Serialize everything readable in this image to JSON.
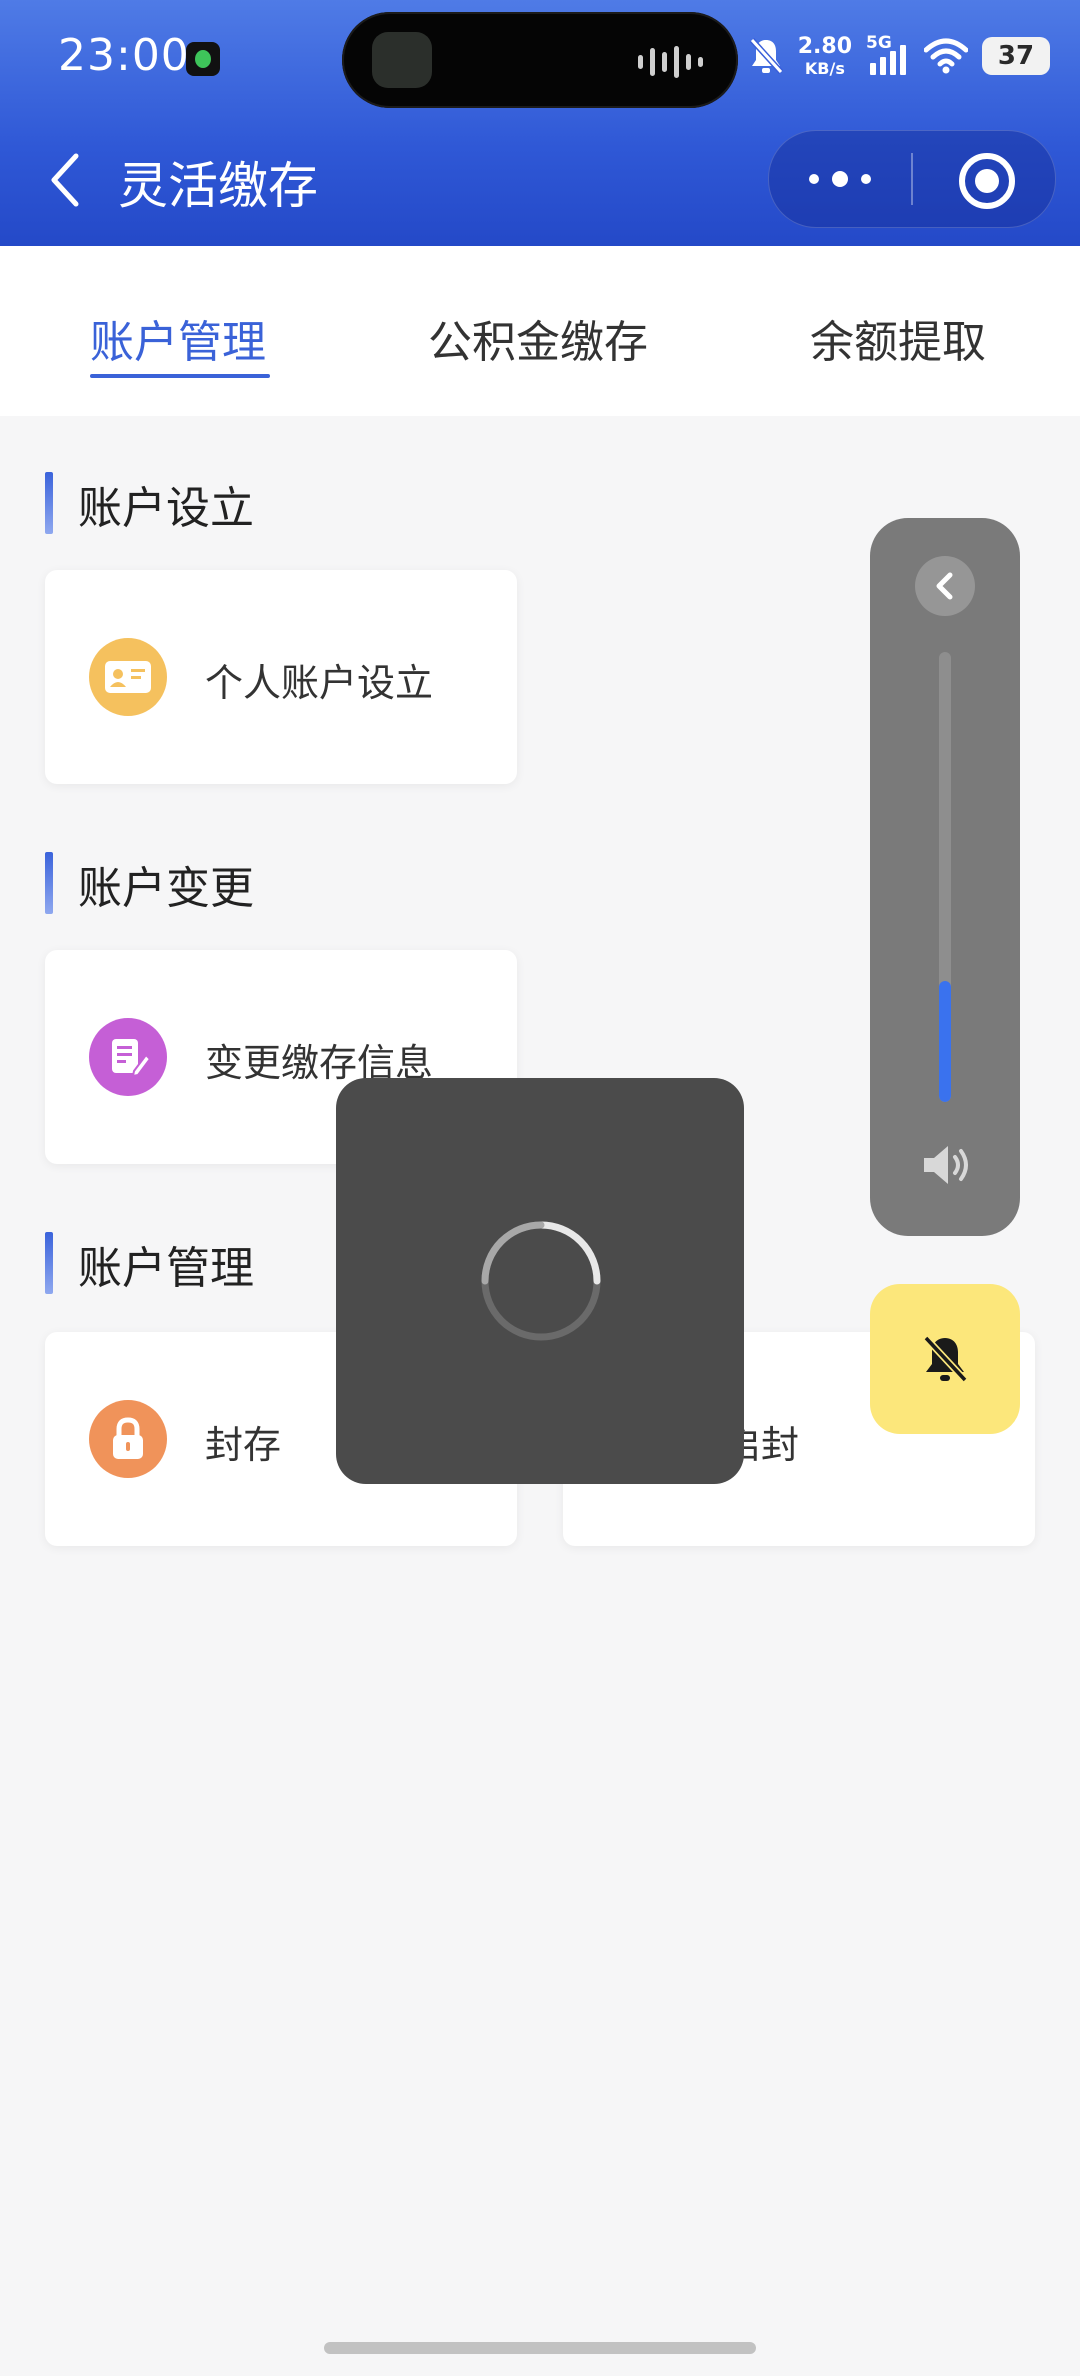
{
  "status_bar": {
    "time": "23:00",
    "net_speed_value": "2.80",
    "net_speed_unit": "KB/s",
    "network_type": "5G",
    "battery": "37"
  },
  "nav": {
    "title": "灵活缴存"
  },
  "tabs": [
    {
      "label": "账户管理",
      "active": true
    },
    {
      "label": "公积金缴存",
      "active": false
    },
    {
      "label": "余额提取",
      "active": false
    }
  ],
  "sections": [
    {
      "title": "账户设立",
      "items": [
        {
          "label": "个人账户设立",
          "icon": "id-card-icon",
          "color": "#f5c15e"
        }
      ]
    },
    {
      "title": "账户变更",
      "items": [
        {
          "label": "变更缴存信息",
          "icon": "edit-document-icon",
          "color": "#c55fd6"
        }
      ]
    },
    {
      "title": "账户管理",
      "items": [
        {
          "label": "封存",
          "icon": "lock-icon",
          "color": "#f0935a"
        },
        {
          "label": "启封",
          "icon": "unlock-icon",
          "color": "#5aa0f0"
        }
      ]
    }
  ],
  "volume": {
    "level": 0.27,
    "accent": "#3a72ee"
  },
  "colors": {
    "brand": "#3a62d8",
    "header_top": "#4f7be6",
    "header_bottom": "#2449c8"
  }
}
